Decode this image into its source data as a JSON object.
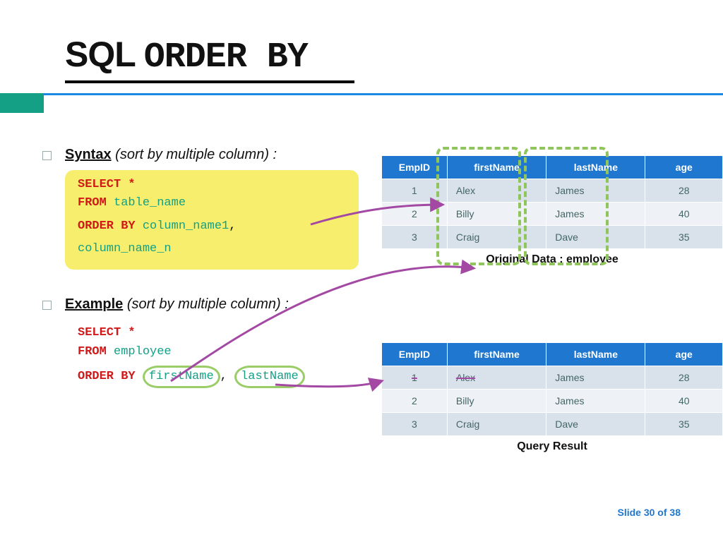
{
  "title": {
    "left": "SQL",
    "right": "ORDER BY"
  },
  "syntax_label": {
    "bold": "Syntax",
    "rest": "(sort by multiple column) :"
  },
  "example_label": {
    "bold": "Example",
    "rest": " (sort by multiple column) :"
  },
  "syntax_code": {
    "select": "SELECT *",
    "from": "FROM",
    "from_id": "table_name",
    "orderby": "ORDER BY",
    "col1": "column_name1",
    "comma": ",",
    "coln": "column_name_n"
  },
  "example_code": {
    "select": "SELECT *",
    "from": "FROM",
    "from_id": "employee",
    "orderby": "ORDER BY",
    "c1": "firstName",
    "c2": "lastName"
  },
  "table1": {
    "headers": [
      "EmpID",
      "firstName",
      "lastName",
      "age"
    ],
    "rows": [
      [
        "1",
        "Alex",
        "James",
        "28"
      ],
      [
        "2",
        "Billy",
        "James",
        "40"
      ],
      [
        "3",
        "Craig",
        "Dave",
        "35"
      ]
    ],
    "caption": "Original Data : employee"
  },
  "table2": {
    "headers": [
      "EmpID",
      "firstName",
      "lastName",
      "age"
    ],
    "rows": [
      [
        "1",
        "Alex",
        "James",
        "28"
      ],
      [
        "2",
        "Billy",
        "James",
        "40"
      ],
      [
        "3",
        "Craig",
        "Dave",
        "35"
      ]
    ],
    "caption": "Query Result"
  },
  "footer": {
    "prefix": "Slide ",
    "num": "30",
    "of": " of ",
    "total": "38"
  }
}
